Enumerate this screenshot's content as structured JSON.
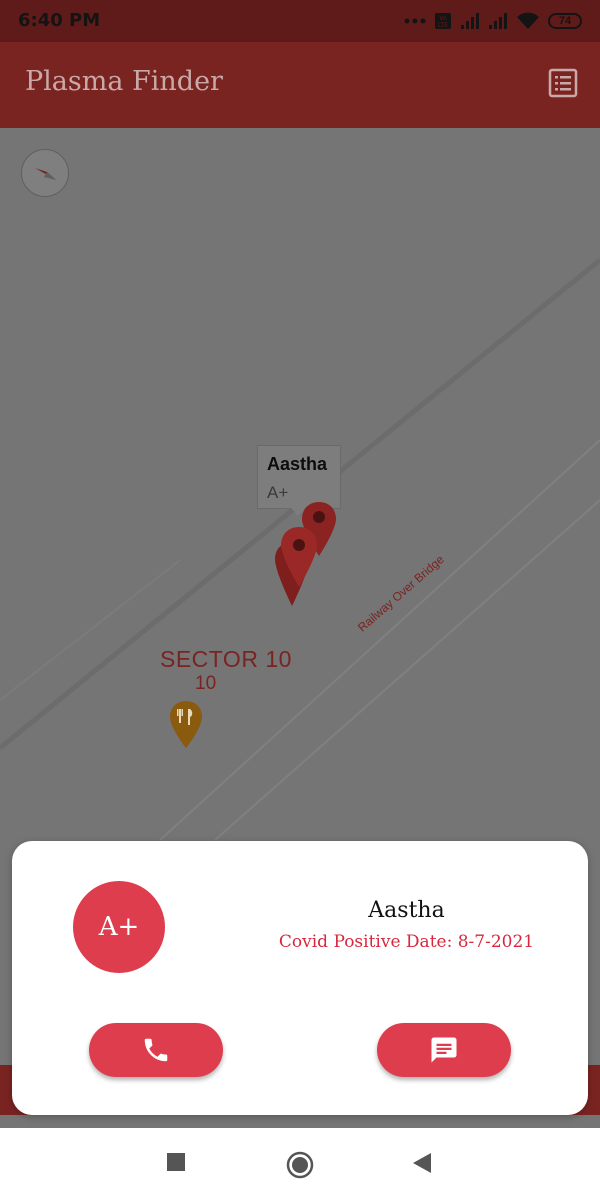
{
  "status_bar": {
    "time": "6:40 PM",
    "battery": "74",
    "icons": [
      "dots-icon",
      "volte-icon",
      "signal-icon",
      "signal-icon",
      "wifi-icon",
      "battery-icon"
    ]
  },
  "app_bar": {
    "title": "Plasma Finder",
    "action_icon": "list-icon"
  },
  "map": {
    "compass_icon": "compass-icon",
    "info_window": {
      "name": "Aastha",
      "blood_group": "A+"
    },
    "labels": {
      "sector": "SECTOR 10",
      "sector_number": "10",
      "road": "Railway Over Bridge"
    },
    "poi_icon": "restaurant-icon"
  },
  "donor_card": {
    "blood_group": "A+",
    "name": "Aastha",
    "covid_positive_date": "Covid Positive Date: 8-7-2021",
    "call_icon": "phone-icon",
    "message_icon": "message-icon"
  },
  "nav_bar": {
    "icons": [
      "recents-icon",
      "home-icon",
      "back-icon"
    ]
  },
  "colors": {
    "accent": "#de3d4e",
    "app_bar": "#7a2422",
    "scrim": "#757575"
  }
}
